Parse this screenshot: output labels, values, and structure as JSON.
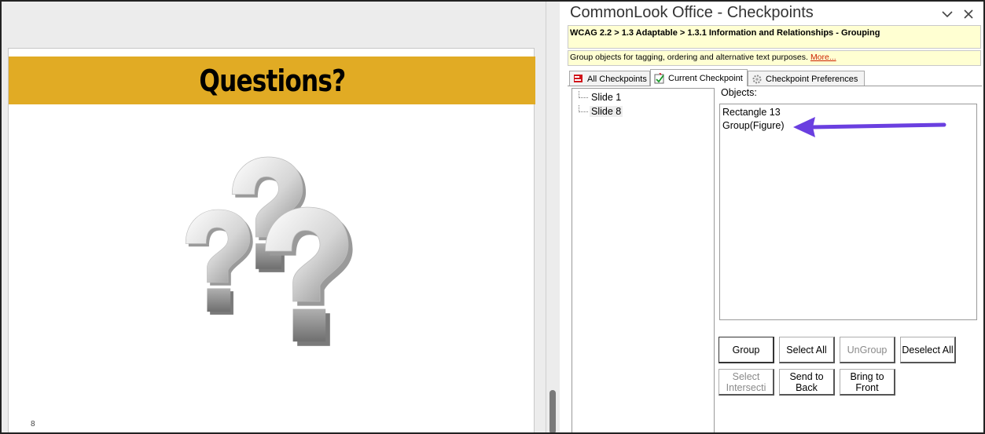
{
  "slide": {
    "title": "Questions?",
    "number": "8",
    "banner_color": "#e1ab24"
  },
  "pane": {
    "title": "CommonLook Office - Checkpoints",
    "dropdown_icon": "chevron-down-icon",
    "close_icon": "close-icon",
    "breadcrumb": "WCAG 2.2 > 1.3 Adaptable > 1.3.1 Information and Relationships - Grouping",
    "description": "Group objects for tagging, ordering and alternative text purposes.",
    "more_link": "More...",
    "highlight_color": "#ffffd2"
  },
  "tabs": [
    {
      "label": "All Checkpoints",
      "icon": "flag-icon"
    },
    {
      "label": "Current Checkpoint",
      "icon": "checklist-icon"
    },
    {
      "label": "Checkpoint Preferences",
      "icon": "gear-icon"
    }
  ],
  "tree": {
    "items": [
      {
        "label": "Slide 1"
      },
      {
        "label": "Slide 8"
      }
    ]
  },
  "objects": {
    "label": "Objects:",
    "items": [
      {
        "label": "Rectangle 13"
      },
      {
        "label": "Group(Figure)"
      }
    ],
    "annotation_arrow_color": "#6a3fe0"
  },
  "buttons": {
    "group": "Group",
    "select_all": "Select All",
    "ungroup": "UnGroup",
    "deselect_all": "Deselect All",
    "select_intersecting": "Select Intersecti",
    "send_to_back": "Send to Back",
    "bring_to_front": "Bring to Front"
  }
}
